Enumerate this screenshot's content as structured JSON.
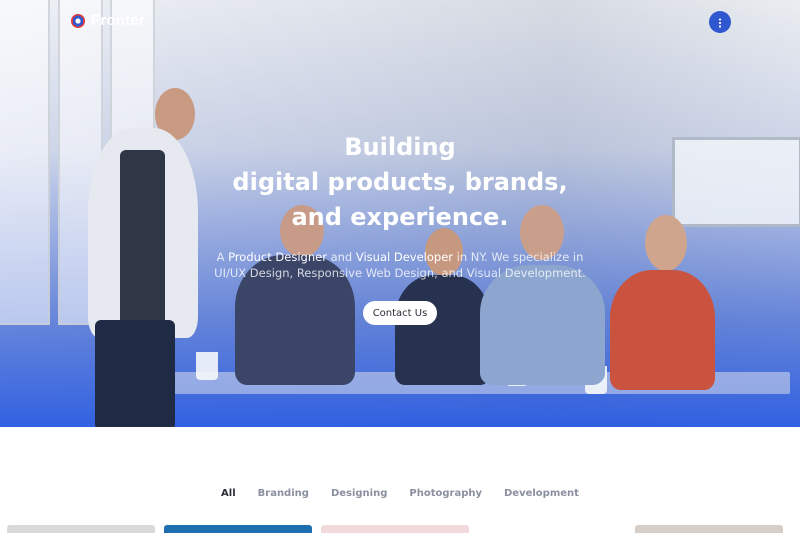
{
  "brand": {
    "name": "Fronter",
    "logo_icon": "fronter-logo-icon"
  },
  "header": {
    "menu_icon": "more-vertical-icon",
    "accent": "#2f57cf"
  },
  "hero": {
    "headline_line1": "Building",
    "headline_line2": "digital products, brands,",
    "headline_line3": "and experience.",
    "sub_prefix": "A ",
    "sub_role1": "Product Designer",
    "sub_and": " and ",
    "sub_role2": "Visual Developer",
    "sub_rest1": " in NY. We specialize in",
    "sub_line2": "UI/UX Design, Responsive Web Design, and Visual Development.",
    "cta_label": "Contact Us",
    "gradient_color": "#285ae1"
  },
  "filters": {
    "tabs": [
      {
        "label": "All",
        "active": true
      },
      {
        "label": "Branding",
        "active": false
      },
      {
        "label": "Designing",
        "active": false
      },
      {
        "label": "Photography",
        "active": false
      },
      {
        "label": "Development",
        "active": false
      }
    ]
  },
  "portfolio": {
    "card_colors": [
      "#d9d9d9",
      "#1f6fb0",
      "#f1d9dc",
      "#ffffff",
      "#d7cfc7"
    ]
  }
}
